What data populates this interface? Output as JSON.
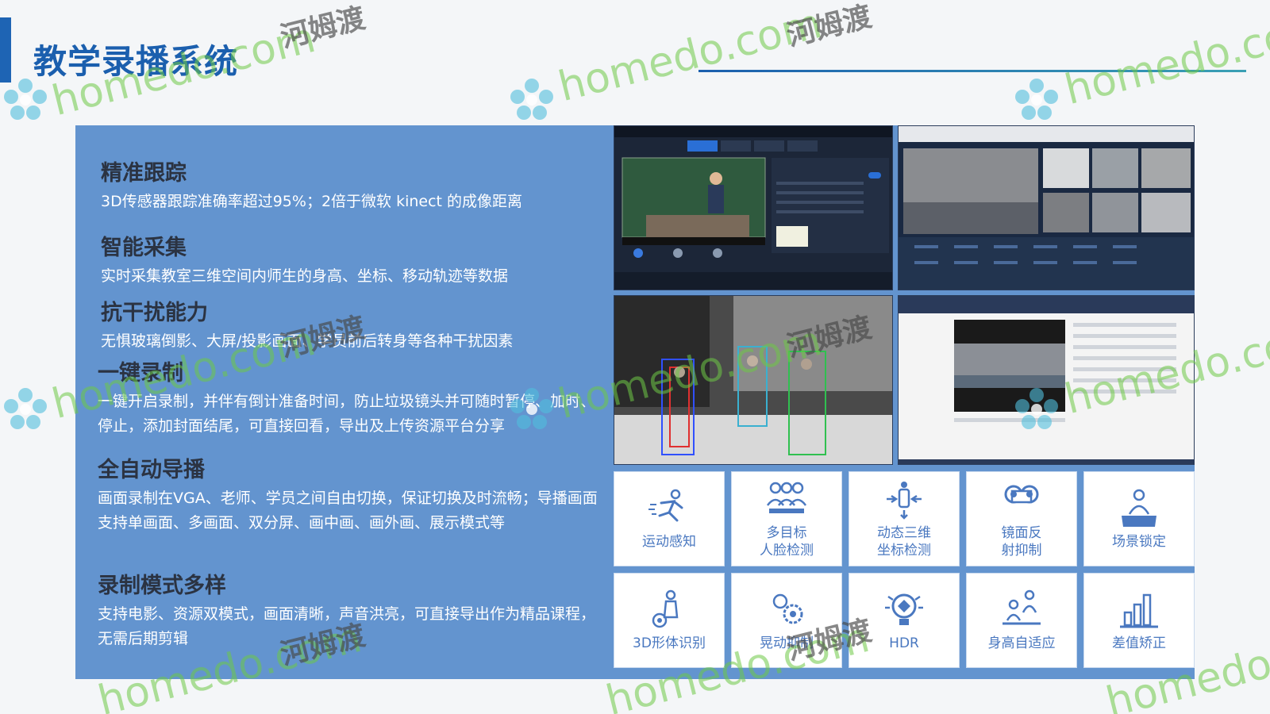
{
  "page": {
    "title": "教学录播系统"
  },
  "features": [
    {
      "title": "精准跟踪",
      "desc": "3D传感器跟踪准确率超过95%；2倍于微软 kinect 的成像距离"
    },
    {
      "title": "智能采集",
      "desc": "实时采集教室三维空间内师生的身高、坐标、移动轨迹等数据"
    },
    {
      "title": "抗干扰能力",
      "desc": "无惧玻璃倒影、大屏/投影画面、学员前后转身等各种干扰因素"
    },
    {
      "title": "一键录制",
      "desc": "一键开启录制，并伴有倒计准备时间，防止垃圾镜头并可随时暂停、加时、停止，添加封面结尾，可直接回看，导出及上传资源平台分享"
    },
    {
      "title": "全自动导播",
      "desc": "画面录制在VGA、老师、学员之间自由切换，保证切换及时流畅；导播画面支持单画面、多画面、双分屏、画中画、画外画、展示模式等"
    },
    {
      "title": "录制模式多样",
      "desc": "支持电影、资源双模式，画面清晰，声音洪亮，可直接导出作为精品课程，无需后期剪辑"
    }
  ],
  "tiles": [
    {
      "label": "运动感知",
      "icon": "running-person-icon"
    },
    {
      "label": "多目标\n人脸检测",
      "icon": "multi-face-icon"
    },
    {
      "label": "动态三维\n坐标检测",
      "icon": "coordinate-icon"
    },
    {
      "label": "镜面反\n射抑制",
      "icon": "mirror-icon"
    },
    {
      "label": "场景锁定",
      "icon": "podium-icon"
    },
    {
      "label": "3D形体识别",
      "icon": "body-icon"
    },
    {
      "label": "晃动抑制",
      "icon": "gear-icon"
    },
    {
      "label": "HDR",
      "icon": "hdr-icon"
    },
    {
      "label": "身高自适应",
      "icon": "height-icon"
    },
    {
      "label": "差值矫正",
      "icon": "bar-chart-icon"
    }
  ],
  "watermarks": {
    "latin": "homedo.com",
    "cn": "河姆渡"
  },
  "colors": {
    "title": "#1b5fae",
    "panel": "#6394cf",
    "tile_label": "#4a78c0"
  }
}
